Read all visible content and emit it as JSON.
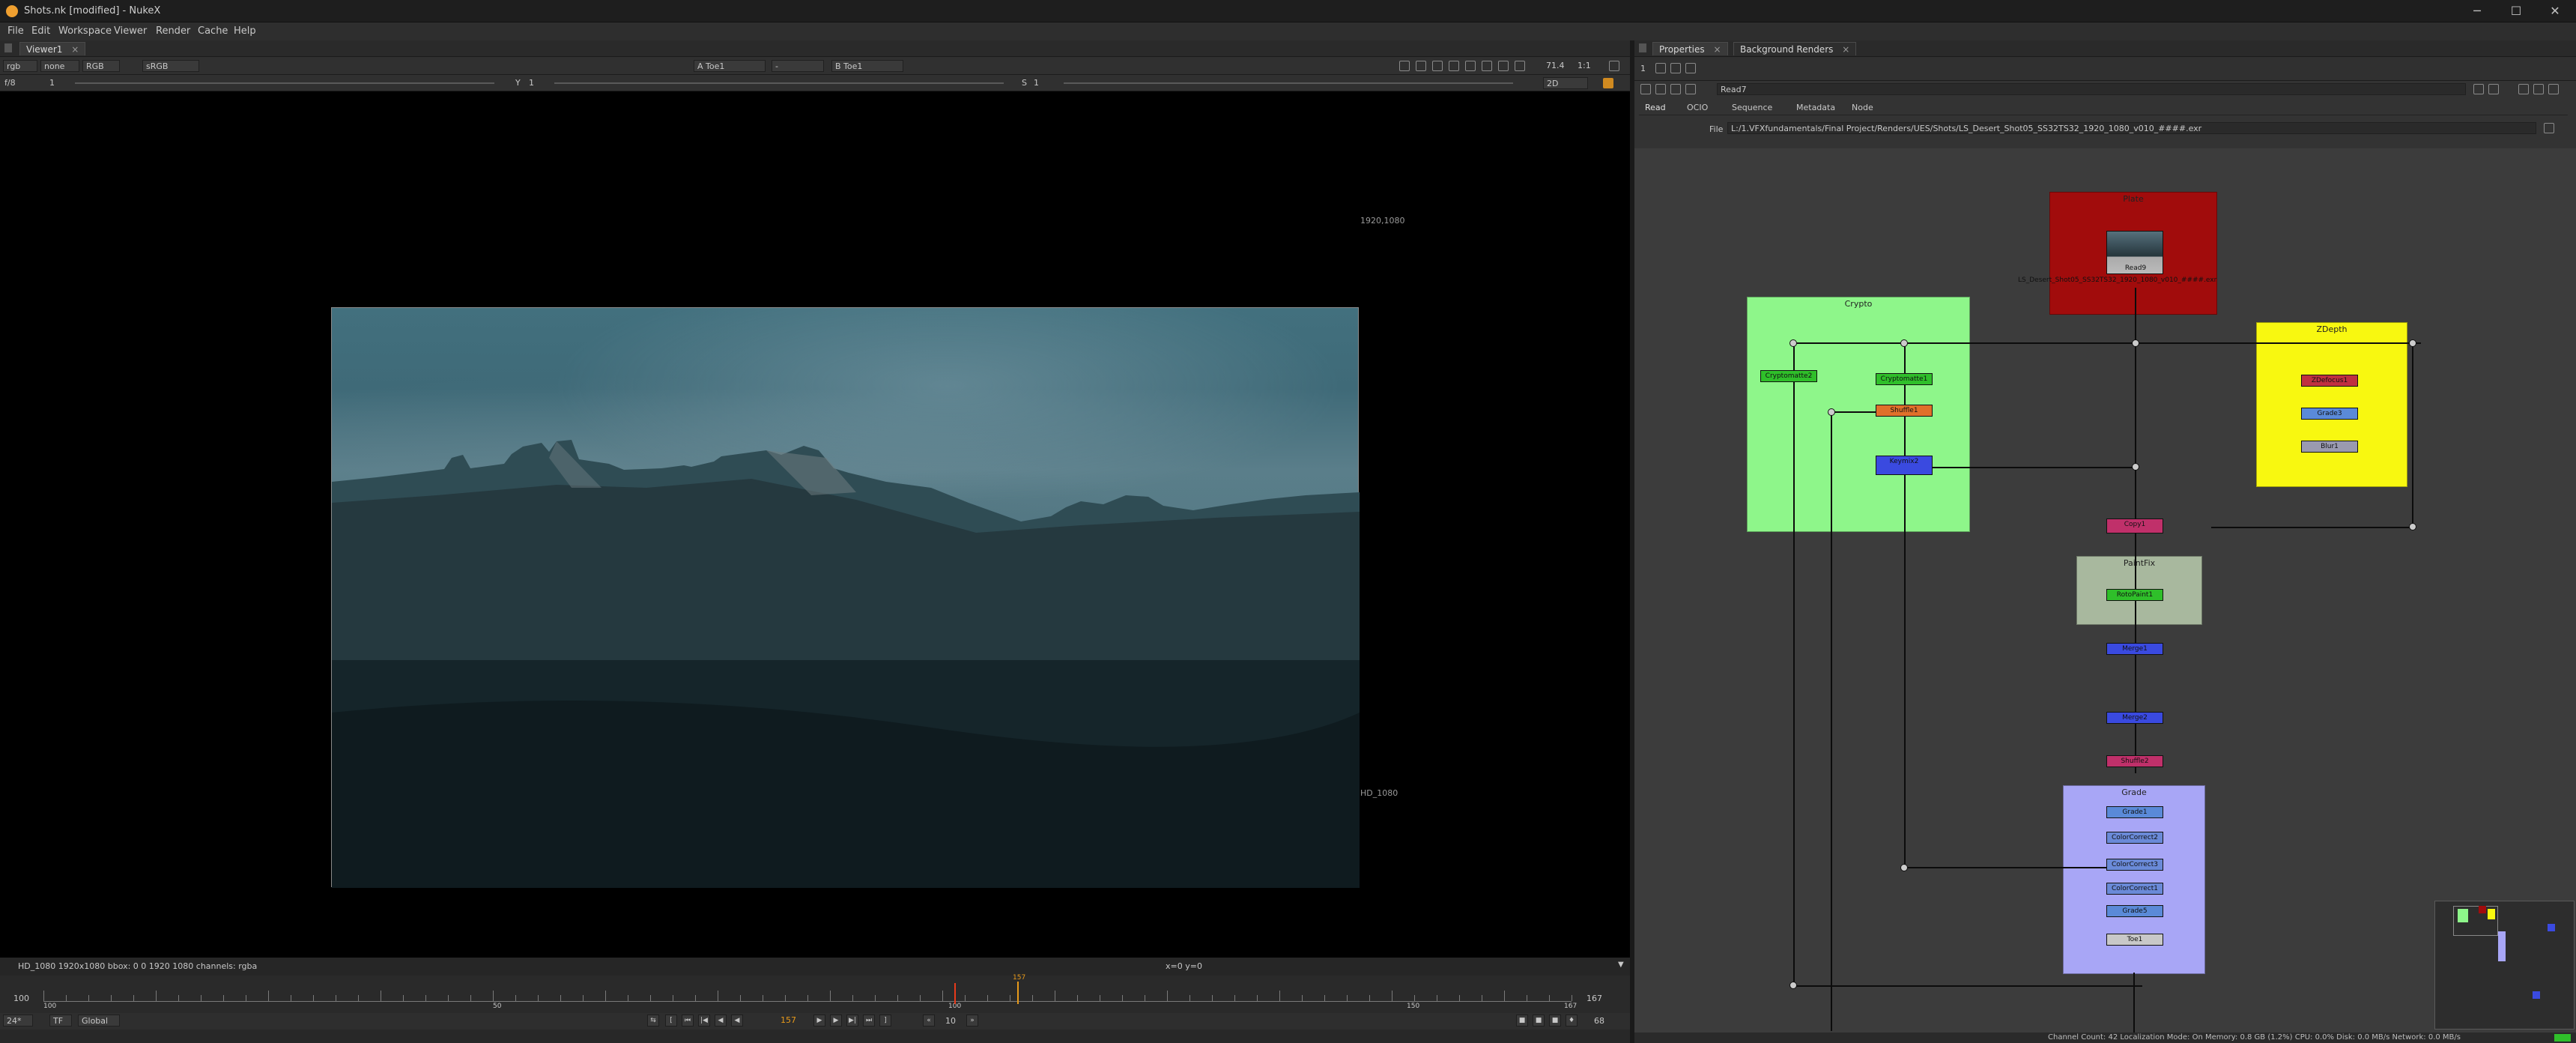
{
  "window": {
    "title": "Shots.nk [modified] - NukeX",
    "minimize": "─",
    "maximize": "☐",
    "close": "✕"
  },
  "menu": [
    "File",
    "Edit",
    "Workspace",
    "Viewer",
    "Render",
    "Cache",
    "Help"
  ],
  "viewer_tab": {
    "label": "Viewer1",
    "close": "×"
  },
  "viewer_toolbar": {
    "channels": "rgb",
    "alpha": "none",
    "rgb_mode": "RGB",
    "lut": "sRGB",
    "input_a": "A  Toe1",
    "wipe": "-",
    "input_b": "B  Toe1",
    "zoom": "71.4",
    "proxy": "1:1",
    "view": "2D"
  },
  "viewer_toolbar2": {
    "fstop": "f/8",
    "frame_y_label": "1",
    "gain_label": "Y",
    "gain_value": "1",
    "gamma_label": "S",
    "gamma_value": "1"
  },
  "viewer": {
    "format_top": "1920,1080",
    "format_bottom": "HD_1080"
  },
  "viewer_status": {
    "info": "HD_1080 1920x1080  bbox: 0 0 1920 1080 channels: rgba",
    "coords": "x=0 y=0"
  },
  "timeline": {
    "start": "100",
    "end": "167",
    "ticks": [
      "100",
      "50",
      "100",
      "150",
      "167"
    ],
    "current": "157"
  },
  "playback": {
    "fps": "24*",
    "tf": "TF",
    "scope": "Global",
    "frame": "157",
    "increment": "10",
    "end_frame": "68"
  },
  "properties": {
    "tabs": [
      {
        "label": "Properties",
        "active": true
      },
      {
        "label": "Background Renders",
        "active": false
      }
    ],
    "count": "1",
    "node_name": "Read7",
    "node_tabs": [
      "Read",
      "OCIO",
      "Sequence",
      "Metadata",
      "Node"
    ],
    "file_label": "File",
    "file_path": "L:/1.VFXfundamentals/Final Project/Renders/UES/Shots/LS_Desert_Shot05_SS32TS32_1920_1080_v010_####.exr"
  },
  "dag": {
    "backdrops": {
      "plate": "Plate",
      "crypto": "Crypto",
      "zdepth": "ZDepth",
      "paintfix": "PaintFix",
      "grade": "Grade"
    },
    "read_node": "Read9",
    "read_caption": "LS_Desert_Shot05_SS32TS32_1920_1080_v010_####.exr",
    "nodes": {
      "crypto_left": "Cryptomatte2",
      "crypto_right": "Cryptomatte1",
      "crypto_shuffle": "Shuffle1",
      "crypto_keymix": "Keymix2",
      "zd1": "ZDefocus1",
      "zd2": "Grade3",
      "zd3": "Blur1",
      "copy": "Copy1",
      "paint": "RotoPaint1",
      "merge1": "Merge1",
      "merge2": "Merge2",
      "shuffle2": "Shuffle2",
      "g1": "Grade1",
      "g2": "ColorCorrect2",
      "g3": "ColorCorrect3",
      "g4": "ColorCorrect1",
      "g5": "Grade5",
      "toe": "Toe1"
    },
    "colors": {
      "plate": "#a10c0c",
      "crypto": "#8ef68a",
      "zdepth": "#f8f810",
      "paintfix": "#a8b89e",
      "grade": "#a8a6f6"
    }
  },
  "footer": {
    "status": "Channel Count: 42 Localization Mode: On Memory: 0.8 GB (1.2%) CPU: 0.0% Disk: 0.0 MB/s Network: 0.0 MB/s"
  }
}
